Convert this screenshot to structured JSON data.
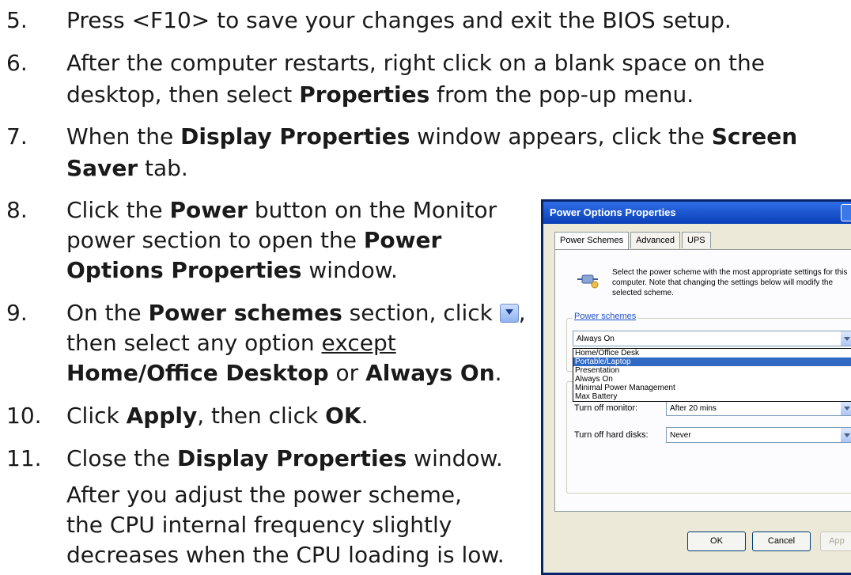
{
  "steps": [
    {
      "num": "5.",
      "parts": [
        "Press <F10> to save your changes and exit the BIOS setup."
      ]
    },
    {
      "num": "6.",
      "line1": "After the computer restarts, right click on a blank space on the",
      "line2_pre": "desktop, then select ",
      "line2_b": "Properties",
      "line2_post": " from the pop-up menu."
    },
    {
      "num": "7.",
      "line1_pre": "When the ",
      "line1_b": "Display Properties",
      "line1_mid": " window appears, click the ",
      "line1_b2": "Screen",
      "line2_b": "Saver",
      "line2_post": " tab."
    },
    {
      "num": "8.",
      "line1_pre": "Click the ",
      "line1_b": "Power",
      "line1_post": " button on the Monitor",
      "line2_pre": "power section to open the ",
      "line2_b": "Power",
      "line3_b": "Options Properties",
      "line3_post": " window."
    },
    {
      "num": "9.",
      "line1_pre": "On the ",
      "line1_b": "Power schemes",
      "line1_post": " section, click ",
      "line1_end": ",",
      "line2_pre": "then select any option ",
      "line2_u": "except",
      "line3_b": "Home/Office Desktop",
      "line3_mid": " or ",
      "line3_b2": "Always On",
      "line3_end": "."
    },
    {
      "num": "10.",
      "pre": "Click ",
      "b": "Apply",
      "mid": ", then click ",
      "b2": "OK",
      "end": "."
    },
    {
      "num": "11.",
      "pre": "Close the ",
      "b": "Display Properties",
      "end": " window."
    }
  ],
  "note": {
    "line1": "After you adjust the power scheme,",
    "line2": "the CPU internal frequency slightly",
    "line3": "decreases when the CPU loading is low."
  },
  "dialog": {
    "title": "Power Options Properties",
    "tabs": [
      "Power Schemes",
      "Advanced",
      "UPS"
    ],
    "description": "Select the power scheme with the most appropriate settings for this computer. Note that changing the settings below will modify the selected scheme.",
    "group_label": "Power schemes",
    "selected_scheme": "Always On",
    "scheme_options": [
      "Home/Office Desk",
      "Portable/Laptop",
      "Presentation",
      "Always On",
      "Minimal Power Management",
      "Max Battery"
    ],
    "turn_off_monitor_label": "Turn off monitor:",
    "turn_off_monitor_value": "After 20 mins",
    "turn_off_disks_label": "Turn off hard disks:",
    "turn_off_disks_value": "Never",
    "ok": "OK",
    "cancel": "Cancel",
    "apply": "App"
  }
}
